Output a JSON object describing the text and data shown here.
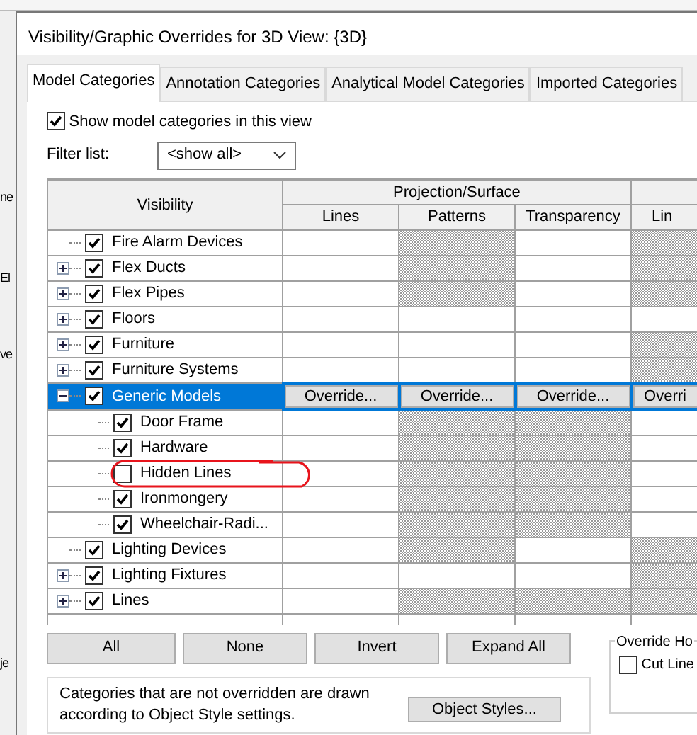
{
  "background_app": {
    "fragments": [
      "ne",
      "El",
      "ve",
      "je"
    ]
  },
  "window": {
    "title": "Visibility/Graphic Overrides for 3D View: {3D}"
  },
  "tabs": [
    {
      "label": "Model Categories",
      "selected": true
    },
    {
      "label": "Annotation Categories",
      "selected": false
    },
    {
      "label": "Analytical Model Categories",
      "selected": false
    },
    {
      "label": "Imported Categories",
      "selected": false
    }
  ],
  "show_categories": {
    "label": "Show model categories in this view",
    "checked": true
  },
  "filter": {
    "label": "Filter list:",
    "value": "<show all>"
  },
  "table": {
    "columns": {
      "visibility": "Visibility",
      "group": "Projection/Surface",
      "sub": [
        "Lines",
        "Patterns",
        "Transparency"
      ],
      "column_5": "Lin"
    },
    "rows": [
      {
        "name": "Fire Alarm Devices",
        "checked": true,
        "selected": false,
        "hatched": [
          false,
          true,
          false,
          true
        ]
      },
      {
        "name": "Flex Ducts",
        "checked": true,
        "selected": false,
        "expanded": false,
        "hatched": [
          false,
          true,
          false,
          true
        ]
      },
      {
        "name": "Flex Pipes",
        "checked": true,
        "selected": false,
        "expanded": false,
        "hatched": [
          false,
          true,
          false,
          true
        ]
      },
      {
        "name": "Floors",
        "checked": true,
        "selected": false,
        "expanded": false,
        "hatched": [
          false,
          false,
          false,
          false
        ]
      },
      {
        "name": "Furniture",
        "checked": true,
        "selected": false,
        "expanded": false,
        "hatched": [
          false,
          false,
          false,
          true
        ]
      },
      {
        "name": "Furniture Systems",
        "checked": true,
        "selected": false,
        "expanded": false,
        "hatched": [
          false,
          false,
          false,
          true
        ]
      },
      {
        "name": "Generic Models",
        "checked": true,
        "selected": true,
        "expanded": true,
        "buttons": [
          "Override...",
          "Override...",
          "Override...",
          "Overri"
        ],
        "children": [
          {
            "name": "Door Frame",
            "checked": true,
            "selected": false,
            "hatched": [
              false,
              true,
              true,
              false
            ]
          },
          {
            "name": "Hardware",
            "checked": true,
            "selected": false,
            "hatched": [
              false,
              true,
              true,
              false
            ]
          },
          {
            "name": "Hidden Lines",
            "checked": false,
            "selected": false,
            "hatched": [
              false,
              true,
              true,
              false
            ]
          },
          {
            "name": "Ironmongery",
            "checked": true,
            "selected": false,
            "hatched": [
              false,
              true,
              true,
              false
            ]
          },
          {
            "name": "Wheelchair-Radi...",
            "checked": true,
            "selected": false,
            "hatched": [
              false,
              true,
              true,
              false
            ]
          }
        ]
      },
      {
        "name": "Lighting Devices",
        "checked": true,
        "selected": false,
        "hatched": [
          false,
          true,
          false,
          true
        ]
      },
      {
        "name": "Lighting Fixtures",
        "checked": true,
        "selected": false,
        "expanded": false,
        "hatched": [
          false,
          false,
          false,
          true
        ]
      },
      {
        "name": "Lines",
        "checked": true,
        "selected": false,
        "expanded": false,
        "hatched": [
          false,
          true,
          true,
          true
        ]
      }
    ]
  },
  "buttons": [
    "All",
    "None",
    "Invert",
    "Expand All"
  ],
  "override_host_layers": {
    "title": "Override Ho",
    "cut_line": {
      "label": "Cut Line",
      "checked": false
    }
  },
  "note": {
    "text": "Categories that are not overridden are drawn according to Object Style settings.",
    "button": "Object Styles..."
  },
  "annotation": {
    "kind": "freehand-ellipse",
    "color": "#e8141c"
  }
}
